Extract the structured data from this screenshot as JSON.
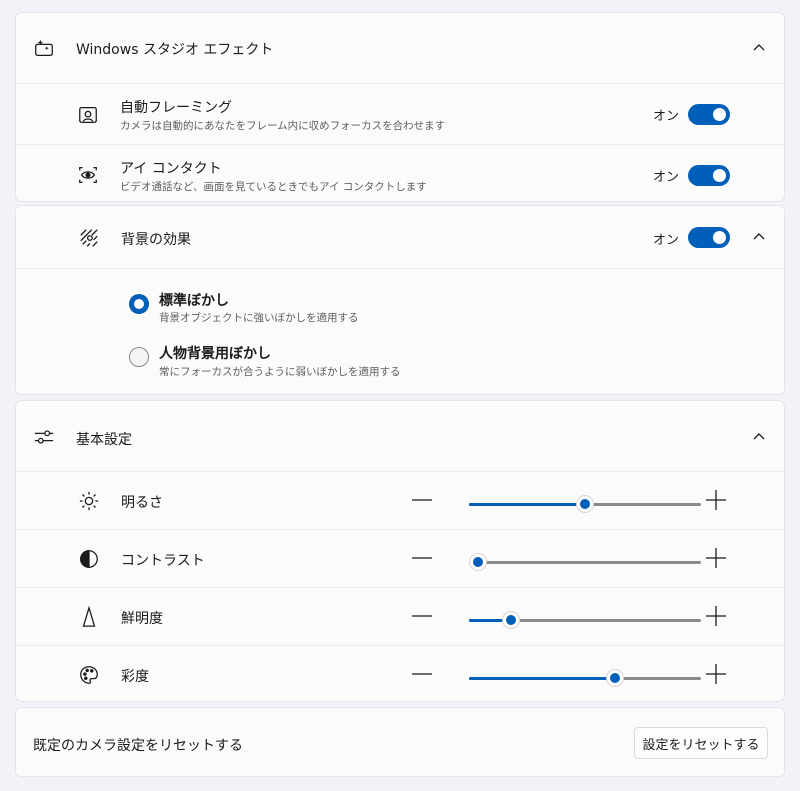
{
  "studio": {
    "header_title": "Windows スタジオ エフェクト",
    "on_label": "オン",
    "auto_framing": {
      "title": "自動フレーミング",
      "subtitle": "カメラは自動的にあなたをフレーム内に収めフォーカスを合わせます",
      "on": true
    },
    "eye_contact": {
      "title": "アイ コンタクト",
      "subtitle": "ビデオ通話など、画面を見ているときでもアイ コンタクトします",
      "on": true
    }
  },
  "background": {
    "title": "背景の効果",
    "on": true,
    "options": [
      {
        "title": "標準ぼかし",
        "subtitle": "背景オブジェクトに強いぼかしを適用する",
        "selected": true
      },
      {
        "title": "人物背景用ぼかし",
        "subtitle": "常にフォーカスが合うように弱いぼかしを適用する",
        "selected": false
      }
    ]
  },
  "basic": {
    "header_title": "基本設定",
    "sliders": [
      {
        "label": "明るさ",
        "icon": "brightness-icon",
        "value": 50
      },
      {
        "label": "コントラスト",
        "icon": "contrast-icon",
        "value": 4
      },
      {
        "label": "鮮明度",
        "icon": "sharpness-icon",
        "value": 18
      },
      {
        "label": "彩度",
        "icon": "saturation-icon",
        "value": 63
      }
    ]
  },
  "reset": {
    "label": "既定のカメラ設定をリセットする",
    "button_label": "設定をリセットする"
  },
  "colors": {
    "accent": "#005fb8",
    "background": "#f1f3f9",
    "card": "#fbfbfb"
  }
}
